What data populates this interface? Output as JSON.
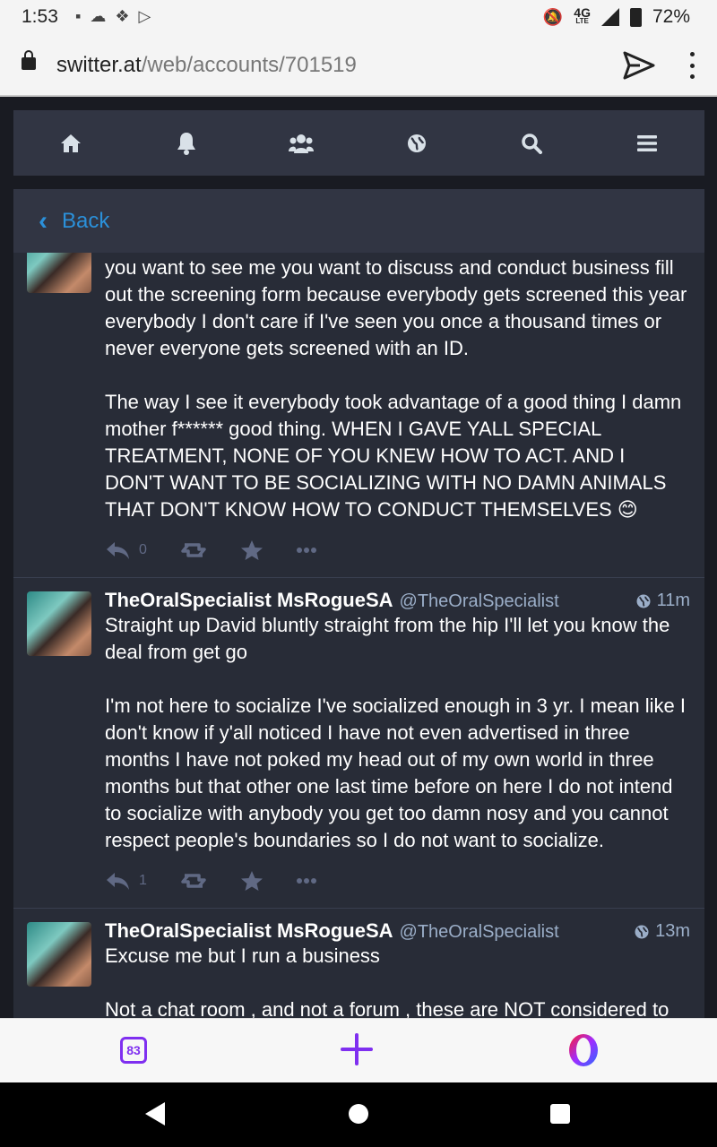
{
  "statusbar": {
    "time": "1:53",
    "notif_icons": [
      "image-icon",
      "cloud-icon",
      "dropbox-icon",
      "play-store-icon"
    ],
    "network": "4G",
    "network_sub": "LTE",
    "battery": "72%"
  },
  "browser": {
    "url_host": "switter.at",
    "url_path": "/web/accounts/701519"
  },
  "appnav": {
    "items": [
      "home-icon",
      "bell-icon",
      "users-icon",
      "globe-icon",
      "search-icon",
      "menu-icon"
    ]
  },
  "column": {
    "back_label": "Back"
  },
  "posts": [
    {
      "paragraphs": [
        "you want to see me you want to discuss and conduct business fill out the screening form because everybody gets screened this year everybody I don't care if I've seen you once a thousand times or never everyone gets screened with an ID.",
        "The way I see it everybody took advantage of a good thing I damn mother f****** good thing. WHEN I GAVE YALL SPECIAL TREATMENT, NONE OF YOU KNEW HOW TO ACT. AND I DON'T WANT TO BE SOCIALIZING WITH NO DAMN ANIMALS THAT DON'T KNOW HOW TO CONDUCT THEMSELVES"
      ],
      "emoji": "😊",
      "reply_count": "0"
    },
    {
      "display_name": "TheOralSpecialist MsRogueSA",
      "acct": "@TheOralSpecialist",
      "time": "11m",
      "paragraphs": [
        "Straight up David bluntly straight from the hip I'll let you know the deal from get go",
        "I'm not here to socialize I've socialized enough in 3 yr. I mean like I don't know if y'all noticed I have not even advertised in three months I have not poked my head out of my own world in three months but that other one last time before on here I do not intend to socialize with anybody you get too damn nosy and you cannot respect people's boundaries so I do not want to socialize."
      ],
      "reply_count": "1"
    },
    {
      "display_name": "TheOralSpecialist MsRogueSA",
      "acct": "@TheOralSpecialist",
      "time": "13m",
      "paragraphs": [
        "Excuse me but I run a business",
        "Not a chat room , and not a forum , these are NOT considered to"
      ]
    }
  ],
  "bottom_bar": {
    "tab_count": "83"
  }
}
